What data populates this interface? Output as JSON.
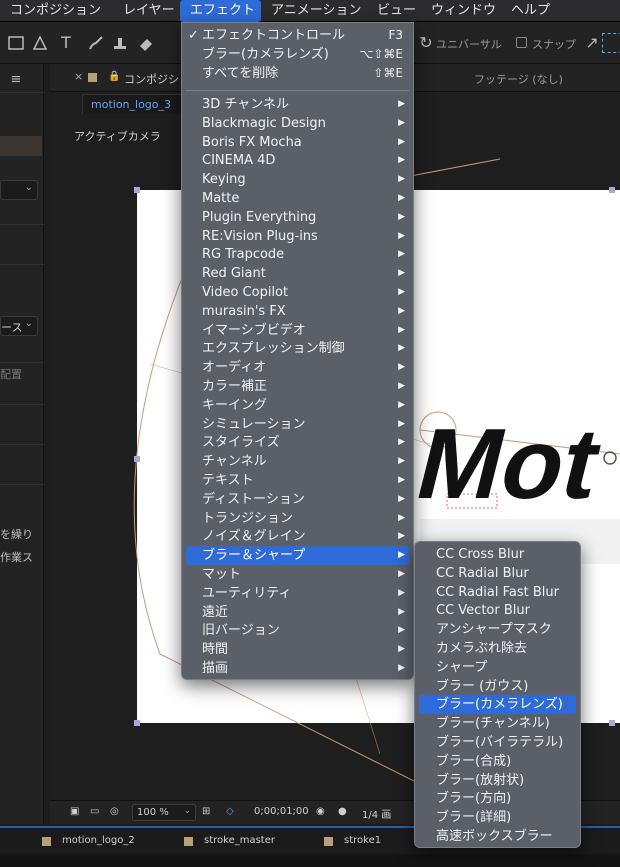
{
  "menubar": {
    "items": [
      "コンポジション",
      "レイヤー",
      "エフェクト",
      "アニメーション",
      "ビュー",
      "ウィンドウ",
      "ヘルプ"
    ],
    "active_index": 2
  },
  "toolbar": {
    "universal": "ユニバーサル",
    "snap": "スナップ"
  },
  "left_panel": {
    "dropdown_1": "ース",
    "dropdown_2": "配置",
    "text_1": "を繰り",
    "text_2": "作業ス"
  },
  "viewer": {
    "tab_label": "コンポジシ",
    "footage_label": "フッテージ (なし)",
    "comp_tab": "motion_logo_3",
    "camera_label": "アクティブカメラ",
    "canvas_text": "Mot"
  },
  "viewer_footer": {
    "zoom": "100 %",
    "timecode": "0;00;01;00",
    "resolution": "1/4 画"
  },
  "timeline_tabs": [
    "motion_logo_2",
    "stroke_master",
    "stroke1"
  ],
  "effect_menu": {
    "top_items": [
      {
        "label": "エフェクトコントロール",
        "shortcut": "F3",
        "checked": true
      },
      {
        "label": "ブラー(カメラレンズ)",
        "shortcut": "⌥⇧⌘E"
      },
      {
        "label": "すべてを削除",
        "shortcut": "⇧⌘E"
      }
    ],
    "items": [
      "3D チャンネル",
      "Blackmagic Design",
      "Boris FX Mocha",
      "CINEMA 4D",
      "Keying",
      "Matte",
      "Plugin Everything",
      "RE:Vision Plug-ins",
      "RG Trapcode",
      "Red Giant",
      "Video Copilot",
      "murasin's FX",
      "イマーシブビデオ",
      "エクスプレッション制御",
      "オーディオ",
      "カラー補正",
      "キーイング",
      "シミュレーション",
      "スタイライズ",
      "チャンネル",
      "テキスト",
      "ディストーション",
      "トランジション",
      "ノイズ＆グレイン",
      "ブラー＆シャープ",
      "マット",
      "ユーティリティ",
      "遠近",
      "旧バージョン",
      "時間",
      "描画"
    ],
    "highlight_index": 24,
    "arrow": "▶"
  },
  "blur_menu": {
    "items": [
      "CC Cross Blur",
      "CC Radial Blur",
      "CC Radial Fast Blur",
      "CC Vector Blur",
      "アンシャープマスク",
      "カメラぶれ除去",
      "シャープ",
      "ブラー (ガウス)",
      "ブラー(カメラレンズ)",
      "ブラー(チャンネル)",
      "ブラー(バイラテラル)",
      "ブラー(合成)",
      "ブラー(放射状)",
      "ブラー(方向)",
      "ブラー(詳細)",
      "高速ボックスブラー"
    ],
    "highlight_index": 8
  },
  "colors": {
    "accent": "#2f6bd8",
    "menu_bg": "#5b6068",
    "comp_link": "#6aa0ff"
  }
}
